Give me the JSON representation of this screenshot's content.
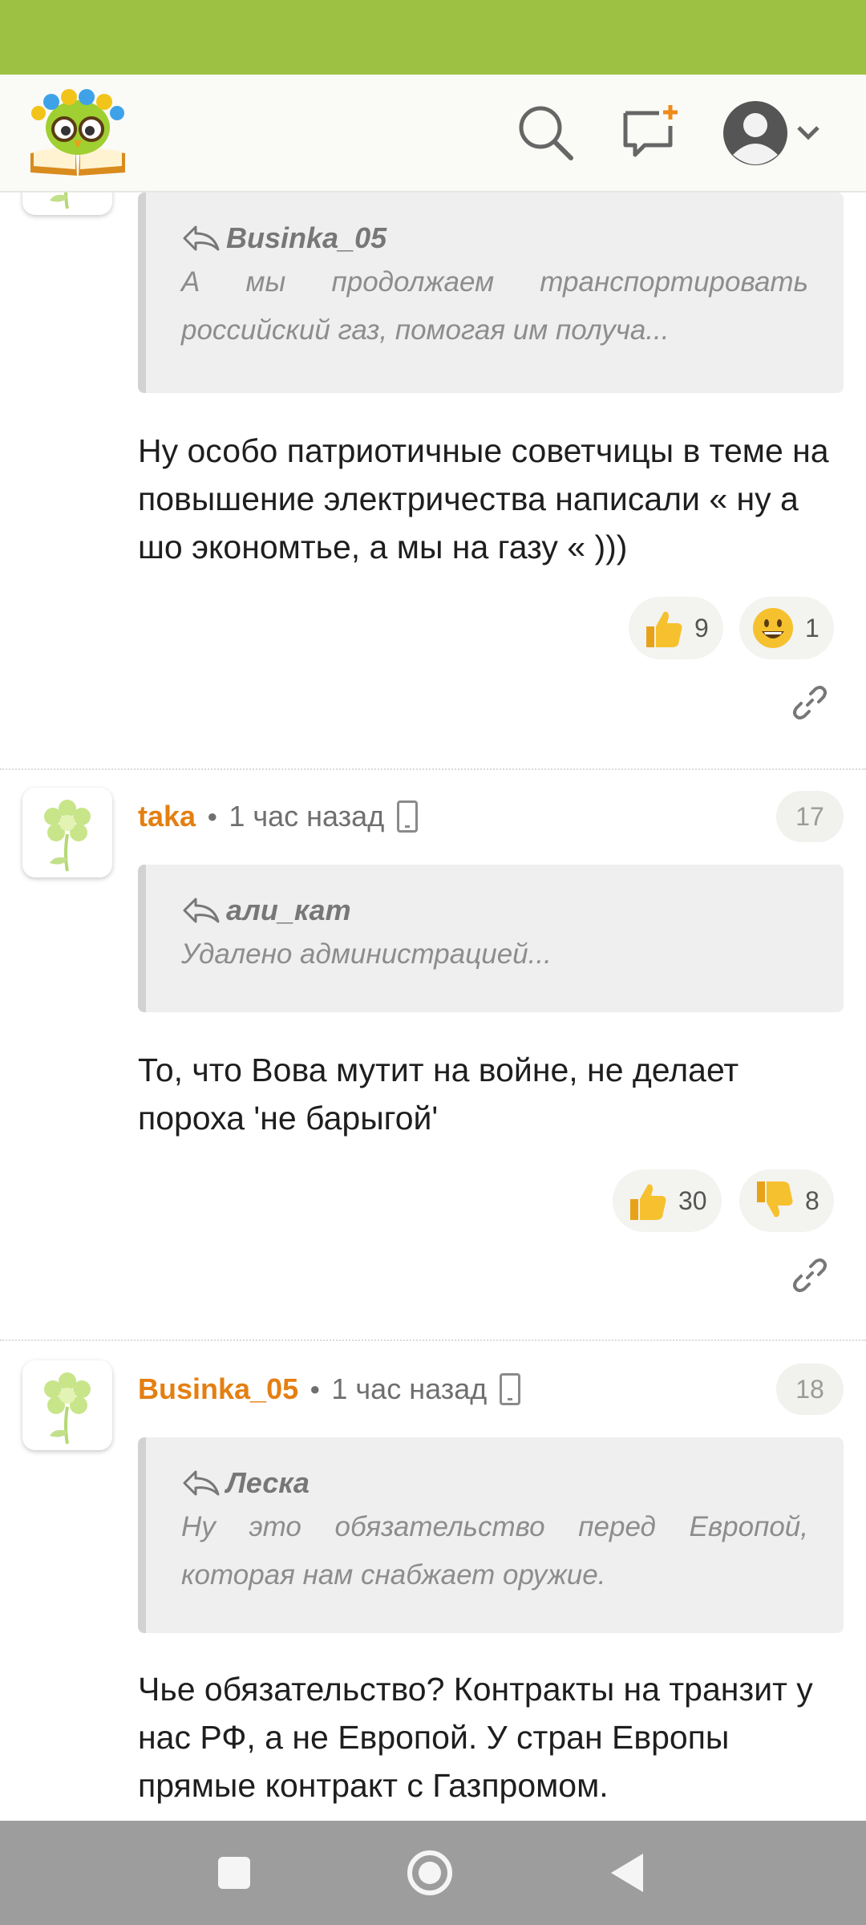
{
  "header": {
    "logo_icon": "owl-on-book-logo",
    "search_icon": "search-icon",
    "new_post_icon": "new-message-icon",
    "profile_icon": "user-avatar-icon",
    "accent": "#9dc243"
  },
  "comments": [
    {
      "quote_author": "Businka_05",
      "quote_text": "А мы продолжаем транспортировать российский газ, помогая им получа...",
      "text": "Ну особо патриотичные советчицы в теме на повышение электричества написали « ну а шо экономтье, а мы на газу « )))",
      "reactions": [
        {
          "icon": "thumbs-up",
          "count": "9"
        },
        {
          "icon": "grinning-face",
          "count": "1"
        }
      ]
    },
    {
      "username": "taka",
      "time": "1 час назад",
      "number": "17",
      "quote_author": "али_кат",
      "quote_text": "Удалено администрацией...",
      "text": "То, что Вова мутит на войне, не делает пороха 'не барыгой'",
      "reactions": [
        {
          "icon": "thumbs-up",
          "count": "30"
        },
        {
          "icon": "thumbs-down",
          "count": "8"
        }
      ]
    },
    {
      "username": "Businka_05",
      "time": "1 час назад",
      "number": "18",
      "quote_author": "Леска",
      "quote_text": "Ну это обязательство перед Европой, которая нам снабжает оружие.",
      "text": "Чье обязательство? Контракты на транзит у нас РФ, а не Европой. У стран Европы прямые контракт с Газпромом."
    }
  ],
  "username_color": "#e47f12"
}
